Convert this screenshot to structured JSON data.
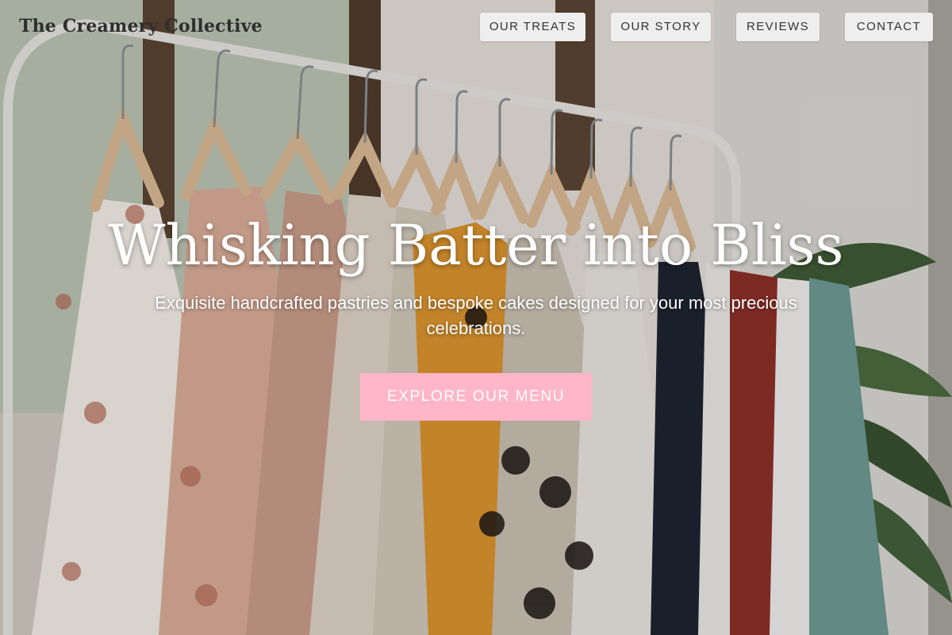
{
  "brand": {
    "name": "The Creamery Collective"
  },
  "nav": {
    "items": [
      {
        "label": "OUR TREATS"
      },
      {
        "label": "OUR STORY"
      },
      {
        "label": "REVIEWS"
      },
      {
        "label": "CONTACT"
      }
    ]
  },
  "hero": {
    "headline": "Whisking Batter into Bliss",
    "subtitle": "Exquisite handcrafted pastries and bespoke cakes designed for your most precious celebrations.",
    "cta_label": "EXPLORE OUR MENU",
    "background": "clothing-rack-photo"
  },
  "colors": {
    "cta": "#ffb6c8",
    "nav_button": "#eeeeee",
    "text_light": "#ffffff",
    "brand_text": "#2e2e2e"
  }
}
